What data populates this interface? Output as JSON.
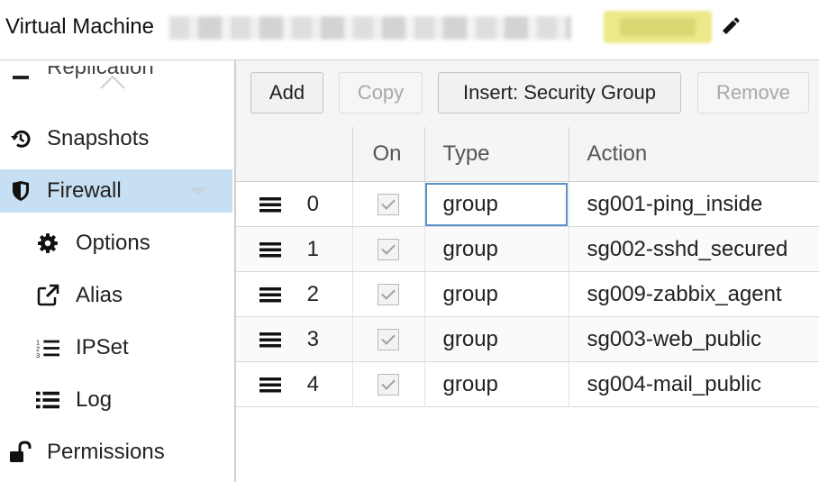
{
  "header": {
    "title": "Virtual Machine",
    "edit_icon": "pencil-icon"
  },
  "sidebar": {
    "partial_item": "Replication",
    "items": [
      {
        "label": "Snapshots",
        "icon": "history-icon"
      },
      {
        "label": "Firewall",
        "icon": "shield-icon",
        "active": true
      },
      {
        "label": "Options",
        "icon": "gear-icon",
        "sub": true
      },
      {
        "label": "Alias",
        "icon": "external-link-icon",
        "sub": true
      },
      {
        "label": "IPSet",
        "icon": "ordered-list-icon",
        "sub": true
      },
      {
        "label": "Log",
        "icon": "list-icon",
        "sub": true
      },
      {
        "label": "Permissions",
        "icon": "unlock-icon"
      }
    ]
  },
  "toolbar": {
    "add": "Add",
    "copy": "Copy",
    "insert_group": "Insert: Security Group",
    "remove": "Remove"
  },
  "table": {
    "columns": [
      "",
      "On",
      "Type",
      "Action"
    ],
    "rows": [
      {
        "pos": "0",
        "on": true,
        "type": "group",
        "action": "sg001-ping_inside"
      },
      {
        "pos": "1",
        "on": true,
        "type": "group",
        "action": "sg002-sshd_secured"
      },
      {
        "pos": "2",
        "on": true,
        "type": "group",
        "action": "sg009-zabbix_agent"
      },
      {
        "pos": "3",
        "on": true,
        "type": "group",
        "action": "sg003-web_public"
      },
      {
        "pos": "4",
        "on": true,
        "type": "group",
        "action": "sg004-mail_public"
      }
    ]
  },
  "colors": {
    "active_nav": "#c7dff3",
    "focus_outline": "#5b8fc7"
  }
}
